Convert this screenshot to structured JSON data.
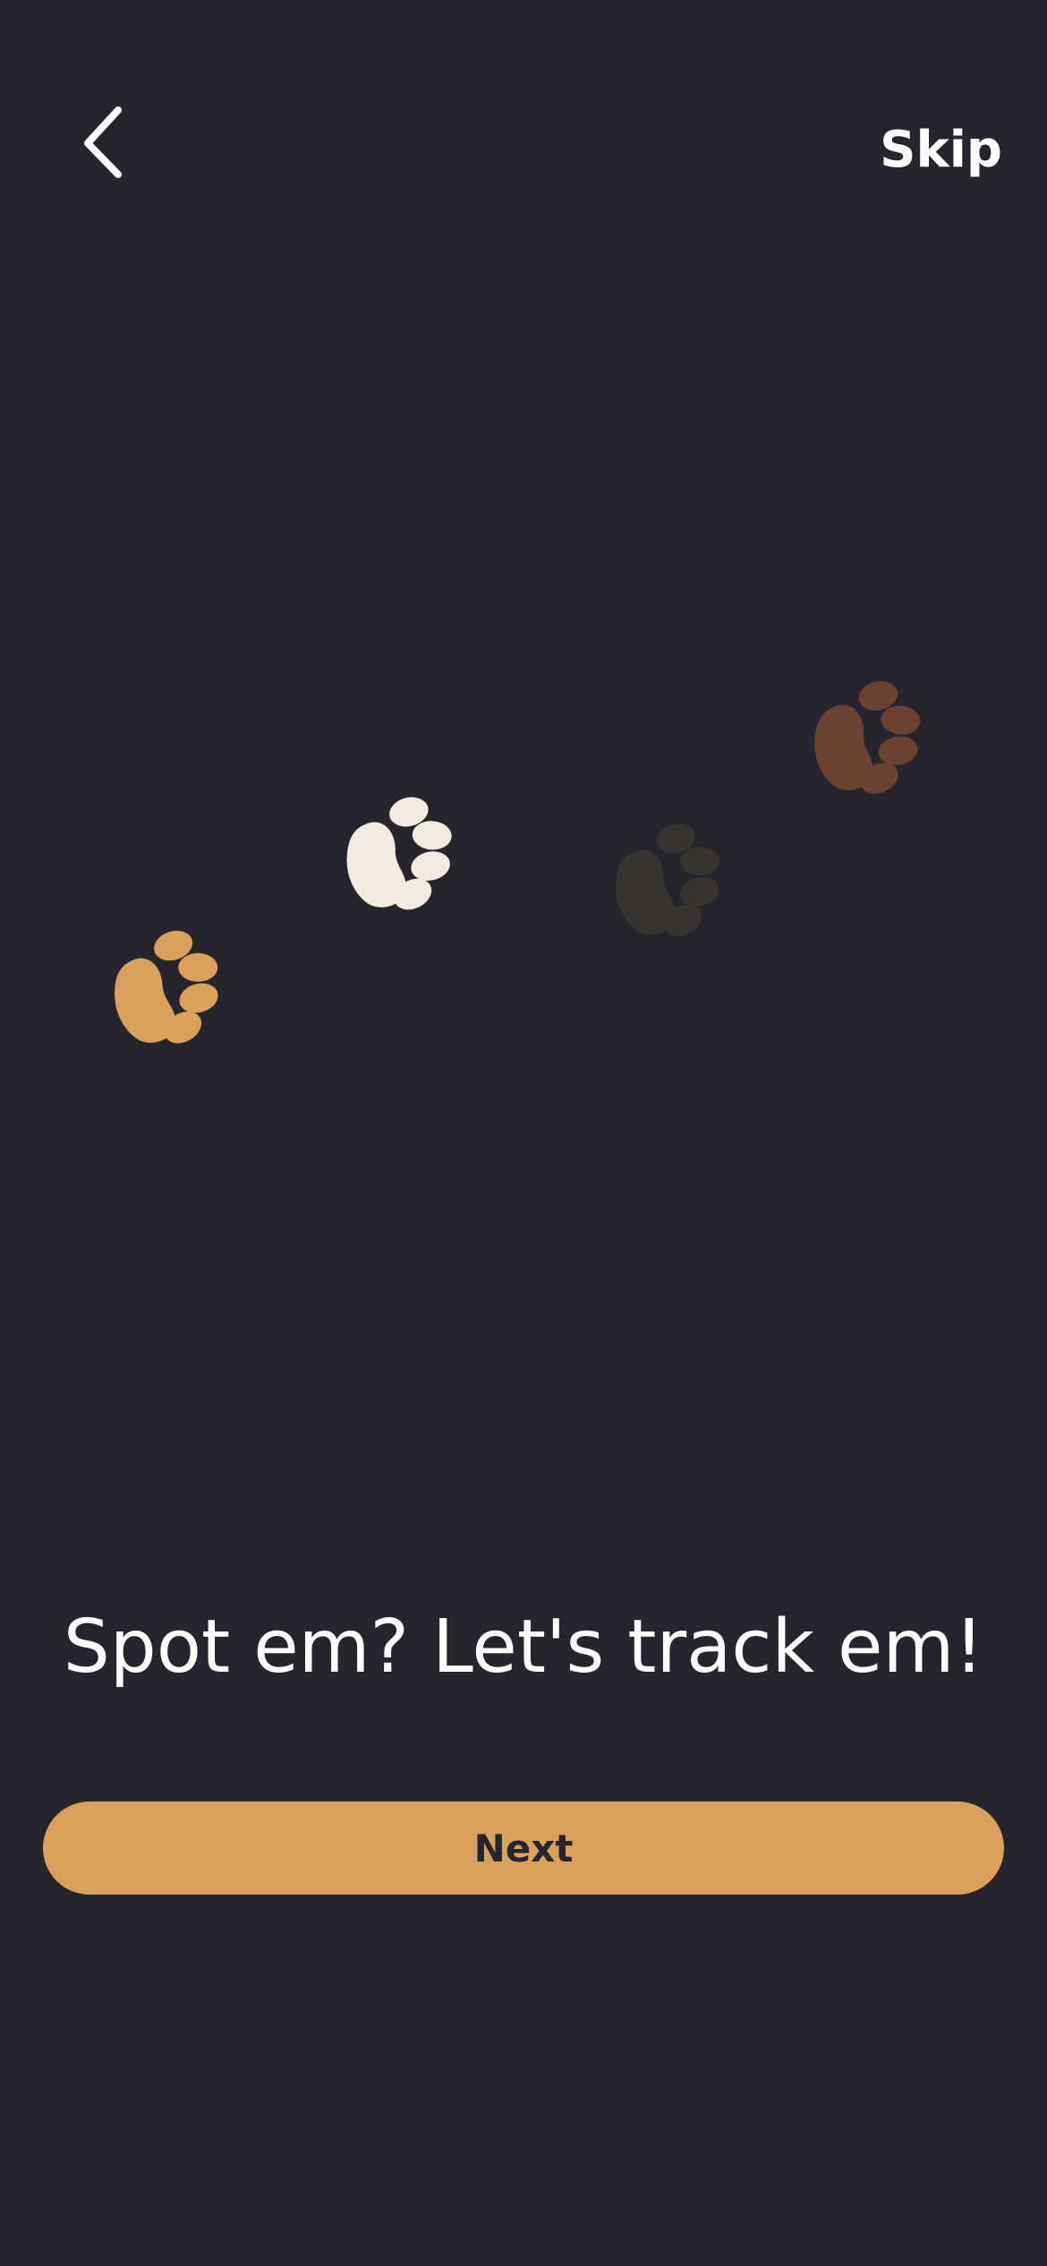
{
  "header": {
    "back_icon": "chevron-left-icon",
    "skip_label": "Skip"
  },
  "illustration": {
    "paws": [
      {
        "icon": "paw-print-icon",
        "color": "#d9a15c"
      },
      {
        "icon": "paw-print-icon",
        "color": "#f3ebdf"
      },
      {
        "icon": "paw-print-icon",
        "color": "#37342f"
      },
      {
        "icon": "paw-print-icon",
        "color": "#6b4231"
      }
    ]
  },
  "main": {
    "headline": "Spot em? Let's track em!"
  },
  "footer": {
    "next_label": "Next",
    "next_color": "#d9a15c"
  }
}
